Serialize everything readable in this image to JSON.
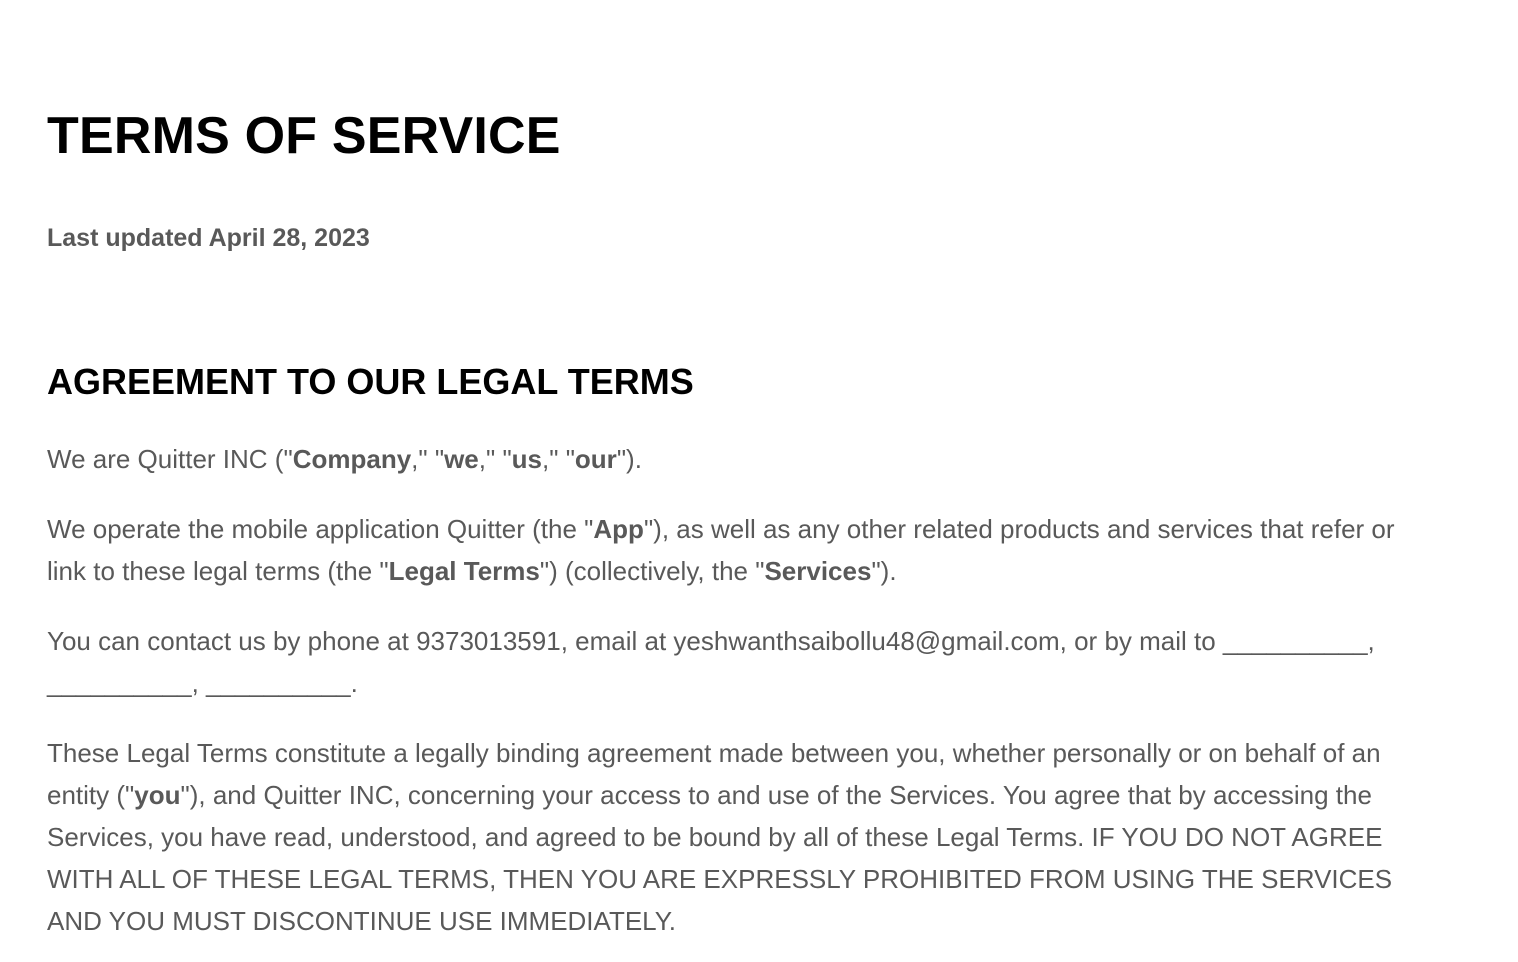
{
  "document": {
    "title": "TERMS OF SERVICE",
    "last_updated": "Last updated April 28, 2023",
    "section_heading": "AGREEMENT TO OUR LEGAL TERMS"
  },
  "para1": {
    "t1": "We are Quitter INC (\"",
    "b1": "Company",
    "t2": ",\" \"",
    "b2": "we",
    "t3": ",\" \"",
    "b3": "us",
    "t4": ",\" \"",
    "b4": "our",
    "t5": "\")."
  },
  "para2": {
    "t1": "We operate the mobile application Quitter (the \"",
    "b1": "App",
    "t2": "\"), as well as any other related products and services that refer or link to these legal terms (the \"",
    "b2": "Legal Terms",
    "t3": "\") (collectively, the \"",
    "b3": "Services",
    "t4": "\")."
  },
  "para3": {
    "text": "You can contact us by phone at 9373013591, email at yeshwanthsaibollu48@gmail.com, or by mail to __________, __________, __________."
  },
  "para4": {
    "t1": "These Legal Terms constitute a legally binding agreement made between you, whether personally or on behalf of an entity (\"",
    "b1": "you",
    "t2": "\"), and Quitter INC, concerning your access to and use of the Services. You agree that by accessing the Services, you have read, understood, and agreed to be bound by all of these Legal Terms. IF YOU DO NOT AGREE WITH ALL OF THESE LEGAL TERMS, THEN YOU ARE EXPRESSLY PROHIBITED FROM USING THE SERVICES AND YOU MUST DISCONTINUE USE IMMEDIATELY."
  },
  "colors": {
    "heading": "#000000",
    "body_text": "#595959",
    "background": "#ffffff"
  }
}
